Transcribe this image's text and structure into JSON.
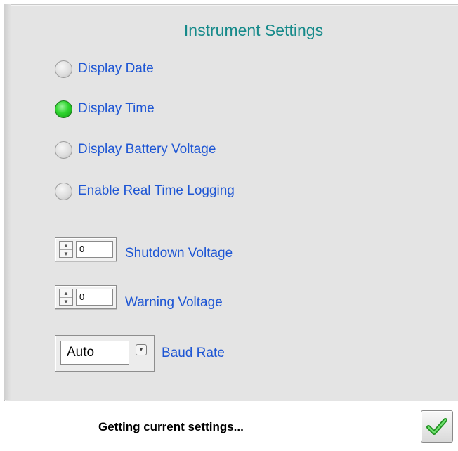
{
  "title": "Instrument Settings",
  "options": [
    {
      "label": "Display Date",
      "selected": false
    },
    {
      "label": "Display Time",
      "selected": true
    },
    {
      "label": "Display Battery Voltage",
      "selected": false
    },
    {
      "label": "Enable Real Time Logging",
      "selected": false
    }
  ],
  "shutdown_voltage": {
    "value": "0",
    "label": "Shutdown Voltage"
  },
  "warning_voltage": {
    "value": "0",
    "label": "Warning Voltage"
  },
  "baud_rate": {
    "value": "Auto",
    "label": "Baud Rate"
  },
  "status": "Getting current settings...",
  "colors": {
    "accent_title": "#168a8a",
    "label_blue": "#1e56d4",
    "radio_on": "#2ed42e"
  },
  "icons": {
    "ok": "checkmark-icon",
    "spin_up": "up-arrow-icon",
    "spin_down": "down-arrow-icon",
    "ring": "dropdown-arrow-icon"
  }
}
